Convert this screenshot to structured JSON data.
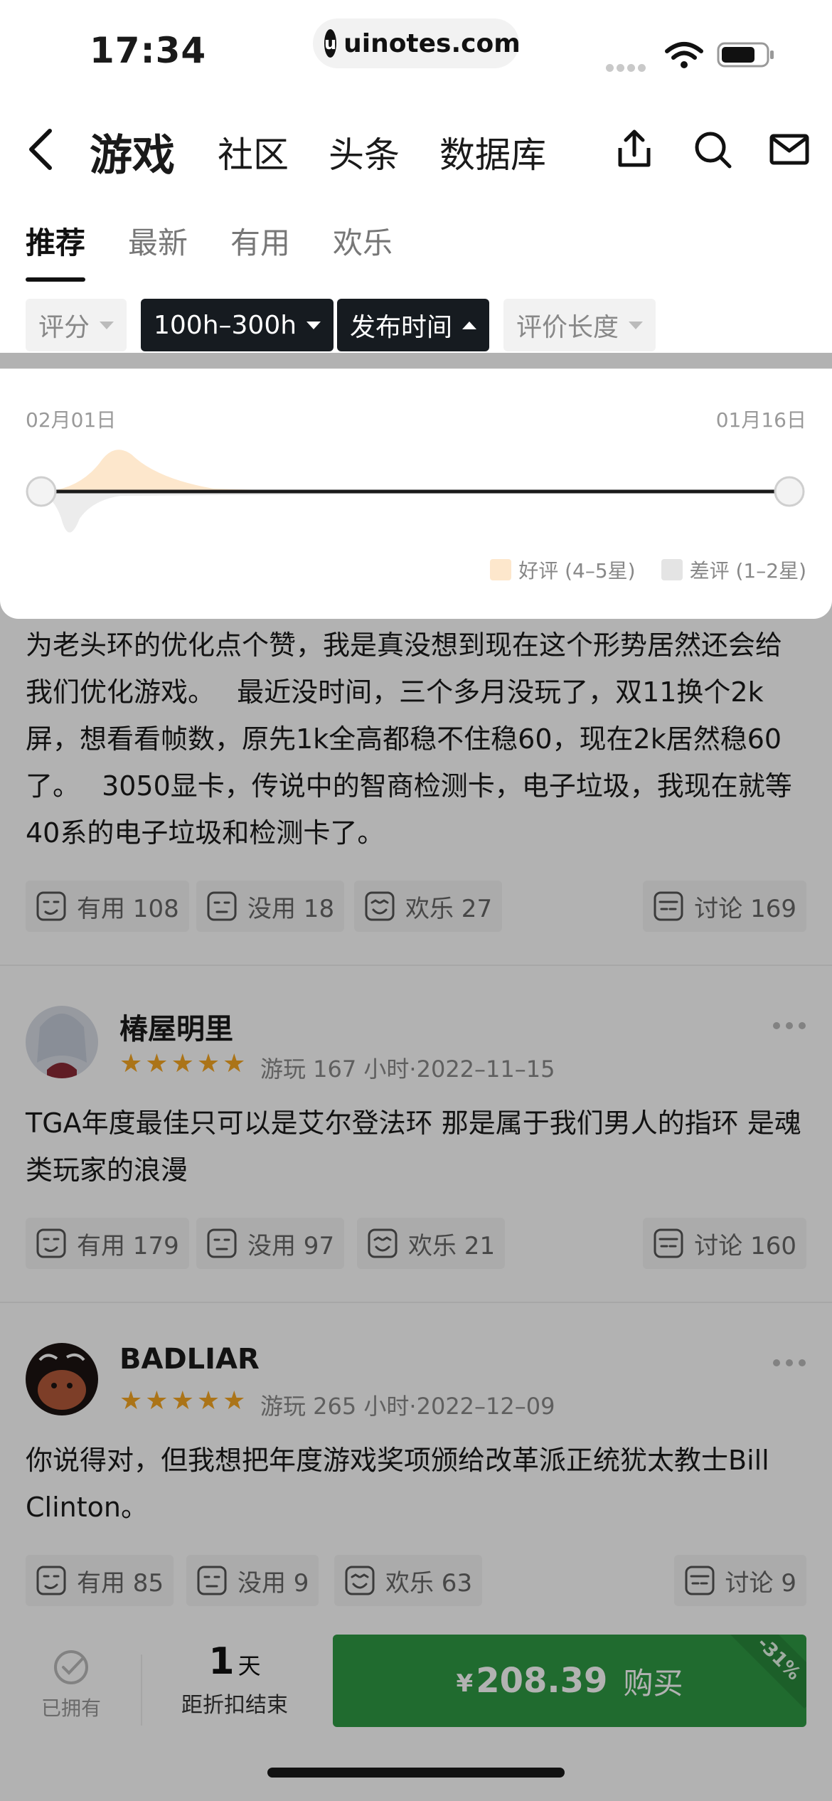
{
  "status_bar": {
    "time": "17:34",
    "url": "uinotes.com"
  },
  "nav": {
    "active_tab": "游戏",
    "tabs": [
      "社区",
      "头条",
      "数据库"
    ],
    "icons": [
      "back-icon",
      "share-icon",
      "search-icon",
      "mail-icon"
    ]
  },
  "subtabs": [
    "推荐",
    "最新",
    "有用",
    "欢乐"
  ],
  "filters": {
    "rating": "评分",
    "playtime": "100h–300h",
    "publish_time": "发布时间",
    "review_length": "评价长度"
  },
  "time_range": {
    "start_label": "02月01日",
    "end_label": "01月16日",
    "legend_positive": "好评 (4–5星)",
    "legend_negative": "差评 (1–2星)",
    "colors": {
      "positive": "#fde7cc",
      "negative": "#e4e4e4"
    }
  },
  "reviews": [
    {
      "text": "为老头环的优化点个赞，我是真没想到现在这个形势居然还会给我们优化游戏。　 最近没时间，三个多月没玩了，双11换个2k屏，想看看帧数，原先1k全高都稳不住稳60，现在2k居然稳60了。　 3050显卡，传说中的智商检测卡，电子垃圾，我现在就等40系的电子垃圾和检测卡了。",
      "useful": "有用 108",
      "useless": "没用 18",
      "fun": "欢乐 27",
      "discuss": "讨论 169"
    },
    {
      "name": "椿屋明里",
      "stars": 5,
      "meta": "游玩 167 小时·2022–11–15",
      "text": "TGA年度最佳只可以是艾尔登法环  那是属于我们男人的指环 是魂类玩家的浪漫",
      "useful": "有用 179",
      "useless": "没用 97",
      "fun": "欢乐 21",
      "discuss": "讨论 160"
    },
    {
      "name": "BADLIAR",
      "stars": 5,
      "meta": "游玩 265 小时·2022–12–09",
      "text": "你说得对，但我想把年度游戏奖项颁给改革派正统犹太教士Bill Clinton。",
      "useful": "有用 85",
      "useless": "没用 9",
      "fun": "欢乐 63",
      "discuss": "讨论 9"
    }
  ],
  "bottom_bar": {
    "owned_label": "已拥有",
    "countdown_number": "1",
    "countdown_unit": "天",
    "countdown_label": "距折扣结束",
    "currency": "¥",
    "price": "208.39",
    "buy_label": "购买",
    "discount": "-31%",
    "accent_color": "#2e9a44"
  }
}
